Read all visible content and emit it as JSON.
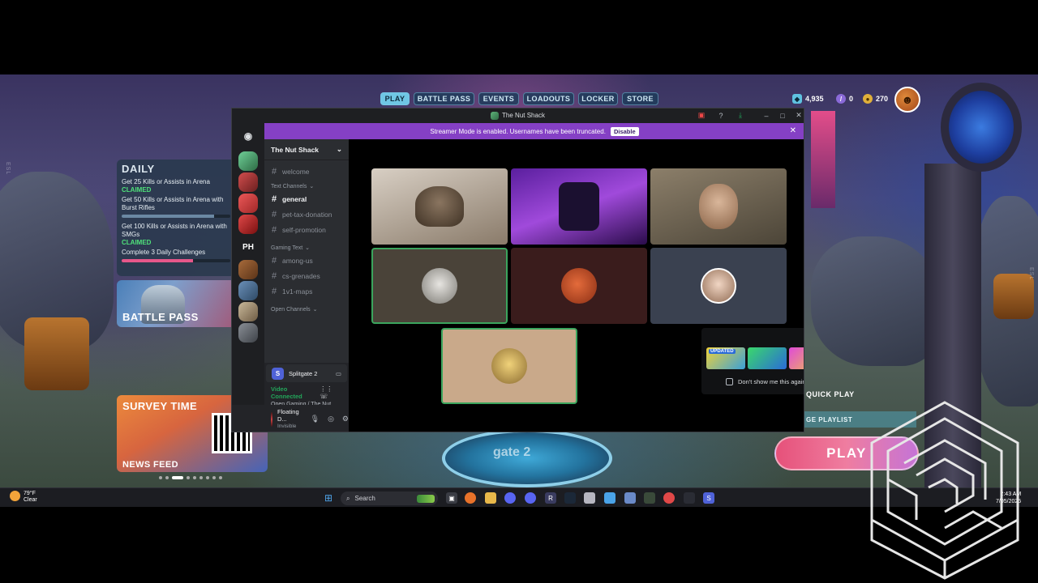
{
  "game": {
    "nav_tabs": [
      "PLAY",
      "BATTLE PASS",
      "EVENTS",
      "LOADOUTS",
      "LOCKER",
      "STORE"
    ],
    "active_tab": "PLAY",
    "currency": {
      "splitcoins": "4,935",
      "prisms": "0",
      "gold": "270"
    },
    "daily": {
      "title": "DAILY",
      "tasks": [
        {
          "label": "Get 25 Kills or Assists in Arena",
          "status": "CLAIMED"
        },
        {
          "label": "Get 50 Kills or Assists in Arena with Burst Rifles",
          "status": ""
        },
        {
          "label": "Get 100 Kills or Assists in Arena with SMGs",
          "status": "CLAIMED"
        },
        {
          "label": "Complete 3 Daily Challenges",
          "status": ""
        }
      ]
    },
    "battle_pass_label": "BATTLE PASS",
    "survey": {
      "title": "SURVEY TIME",
      "footer": "NEWS FEED"
    },
    "quick_play": "QUICK PLAY",
    "playlist": "GE PLAYLIST",
    "play_button": "PLAY",
    "platform_text": "gate 2"
  },
  "discord": {
    "window_title": "The Nut Shack",
    "streamer_banner": "Streamer Mode is enabled. Usernames have been truncated.",
    "streamer_disable": "Disable",
    "server_name": "The Nut Shack",
    "rail_ph": "PH",
    "channels_top": [
      "welcome"
    ],
    "categories": [
      {
        "name": "Text Channels",
        "channels": [
          "general",
          "pet-tax-donation",
          "self-promotion"
        ]
      },
      {
        "name": "Gaming Text",
        "channels": [
          "among-us",
          "cs-grenades",
          "1v1-maps"
        ]
      },
      {
        "name": "Open Channels",
        "channels": []
      }
    ],
    "active_channel": "general",
    "activity_game": "Splitgate 2",
    "voice_status": "Video Connected",
    "voice_location": "Open Gaming / The Nut...",
    "user": {
      "name": "Floating D...",
      "status": "Invisible"
    },
    "notify_checkbox": "Don't show me this again.",
    "notify_badge": "UPDATED"
  },
  "taskbar": {
    "weather_temp": "79°F",
    "weather_desc": "Clear",
    "search_placeholder": "Search",
    "time": "2:43 AM",
    "date": "7/05/2025"
  },
  "colors": {
    "discord_accent": "#8540c5",
    "voice_green": "#23a55a",
    "play_pink": "#e6517a",
    "nav_active": "#6fc6e4"
  }
}
